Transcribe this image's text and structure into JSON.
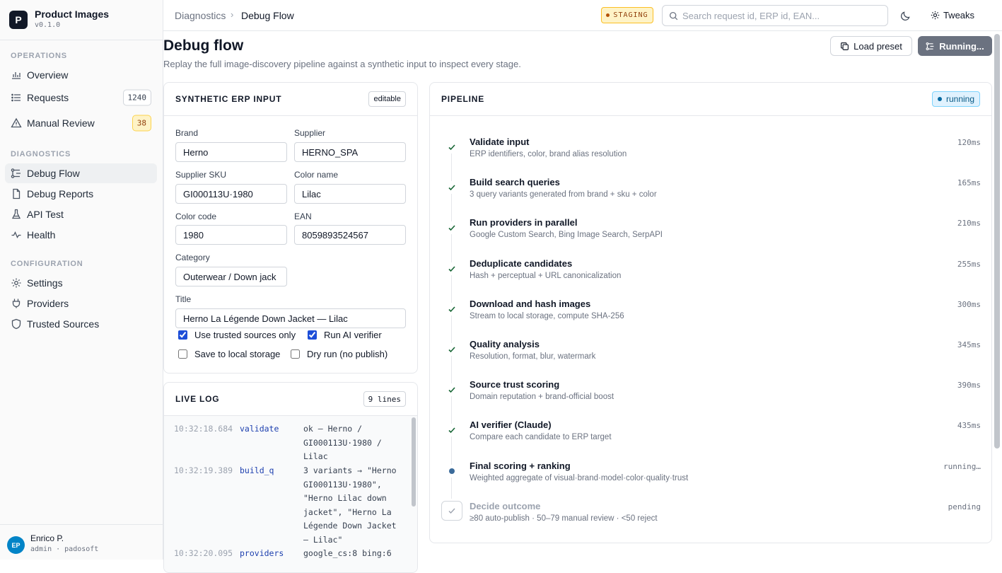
{
  "app": {
    "name": "Product Images",
    "version": "v0.1.0",
    "logo_letter": "P"
  },
  "sidebar": {
    "sections": [
      {
        "title": "OPERATIONS",
        "items": [
          {
            "label": "Overview",
            "icon": "bar-chart-icon"
          },
          {
            "label": "Requests",
            "icon": "list-icon",
            "count": "1240"
          },
          {
            "label": "Manual Review",
            "icon": "alert-triangle-icon",
            "count": "38"
          }
        ]
      },
      {
        "title": "DIAGNOSTICS",
        "items": [
          {
            "label": "Debug Flow",
            "icon": "flow-icon",
            "active": true
          },
          {
            "label": "Debug Reports",
            "icon": "file-icon"
          },
          {
            "label": "API Test",
            "icon": "flask-icon"
          },
          {
            "label": "Health",
            "icon": "activity-icon"
          }
        ]
      },
      {
        "title": "CONFIGURATION",
        "items": [
          {
            "label": "Settings",
            "icon": "gear-icon"
          },
          {
            "label": "Providers",
            "icon": "plug-icon"
          },
          {
            "label": "Trusted Sources",
            "icon": "shield-icon"
          }
        ]
      }
    ]
  },
  "user": {
    "initials": "EP",
    "name": "Enrico P.",
    "role": "admin · padosoft"
  },
  "topbar": {
    "breadcrumb": [
      "Diagnostics",
      "Debug Flow"
    ],
    "env_badge": "STAGING",
    "search_placeholder": "Search request id, ERP id, EAN...",
    "tweaks_label": "Tweaks"
  },
  "page": {
    "title": "Debug flow",
    "subtitle": "Replay the full image-discovery pipeline against a synthetic input to inspect every stage.",
    "load_preset_label": "Load preset",
    "run_label": "Running..."
  },
  "erp_input": {
    "title": "SYNTHETIC ERP INPUT",
    "badge": "editable",
    "fields": {
      "brand": {
        "label": "Brand",
        "value": "Herno"
      },
      "supplier": {
        "label": "Supplier",
        "value": "HERNO_SPA"
      },
      "supplier_sku": {
        "label": "Supplier SKU",
        "value": "GI000113U·1980"
      },
      "color_name": {
        "label": "Color name",
        "value": "Lilac"
      },
      "color_code": {
        "label": "Color code",
        "value": "1980"
      },
      "ean": {
        "label": "EAN",
        "value": "8059893524567"
      },
      "category": {
        "label": "Category",
        "value": "Outerwear / Down jack"
      },
      "title": {
        "label": "Title",
        "value": "Herno La Légende Down Jacket — Lilac"
      }
    },
    "options": [
      {
        "label": "Use trusted sources only",
        "checked": true
      },
      {
        "label": "Run AI verifier",
        "checked": true
      },
      {
        "label": "Save to local storage",
        "checked": false
      },
      {
        "label": "Dry run (no publish)",
        "checked": false
      }
    ]
  },
  "live_log": {
    "title": "LIVE LOG",
    "badge": "9 lines",
    "entries": [
      {
        "time": "10:32:18.684",
        "stage": "validate",
        "message": "ok — Herno / GI000113U·1980 / Lilac"
      },
      {
        "time": "10:32:19.389",
        "stage": "build_q",
        "message": "3 variants → \"Herno GI000113U·1980\", \"Herno Lilac down jacket\", \"Herno La Légende Down Jacket — Lilac\""
      },
      {
        "time": "10:32:20.095",
        "stage": "providers",
        "message": "google_cs:8 bing:6"
      }
    ]
  },
  "pipeline": {
    "title": "PIPELINE",
    "status": "running",
    "steps": [
      {
        "name": "Validate input",
        "desc": "ERP identifiers, color, brand alias resolution",
        "time": "120ms",
        "state": "done"
      },
      {
        "name": "Build search queries",
        "desc": "3 query variants generated from brand + sku + color",
        "time": "165ms",
        "state": "done"
      },
      {
        "name": "Run providers in parallel",
        "desc": "Google Custom Search, Bing Image Search, SerpAPI",
        "time": "210ms",
        "state": "done"
      },
      {
        "name": "Deduplicate candidates",
        "desc": "Hash + perceptual + URL canonicalization",
        "time": "255ms",
        "state": "done"
      },
      {
        "name": "Download and hash images",
        "desc": "Stream to local storage, compute SHA-256",
        "time": "300ms",
        "state": "done"
      },
      {
        "name": "Quality analysis",
        "desc": "Resolution, format, blur, watermark",
        "time": "345ms",
        "state": "done"
      },
      {
        "name": "Source trust scoring",
        "desc": "Domain reputation + brand-official boost",
        "time": "390ms",
        "state": "done"
      },
      {
        "name": "AI verifier (Claude)",
        "desc": "Compare each candidate to ERP target",
        "time": "435ms",
        "state": "done"
      },
      {
        "name": "Final scoring + ranking",
        "desc": "Weighted aggregate of visual·brand·model·color·quality·trust",
        "time": "running…",
        "state": "running"
      },
      {
        "name": "Decide outcome",
        "desc": "≥80 auto-publish · 50–79 manual review · <50 reject",
        "time": "pending",
        "state": "pending"
      }
    ]
  },
  "colors": {
    "accent": "#1d4ed8",
    "success": "#166534",
    "running": "#3b6b9a",
    "warning": "#fef3c7"
  }
}
